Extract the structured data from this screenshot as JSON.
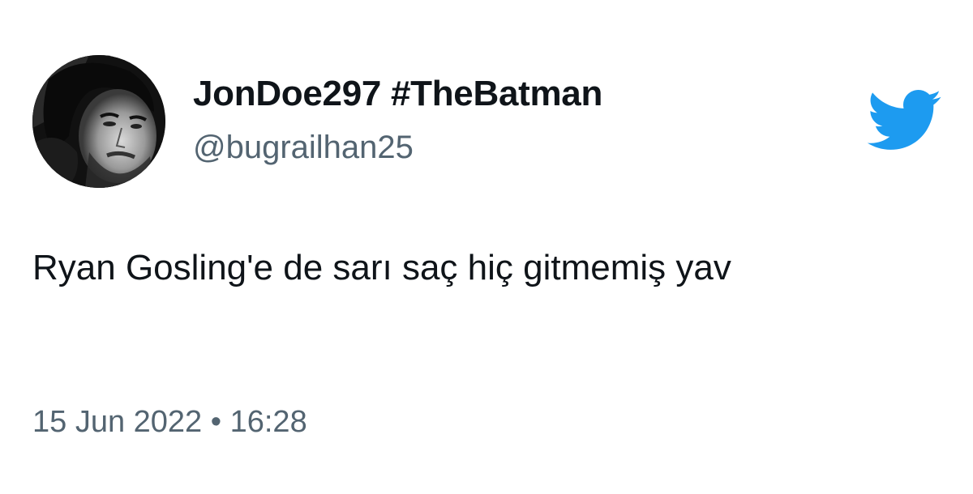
{
  "tweet": {
    "display_name": "JonDoe297 #TheBatman",
    "handle": "@bugrailhan25",
    "text": "Ryan Gosling'e de sarı saç hiç gitmemiş yav",
    "timestamp": "15 Jun 2022 • 16:28"
  },
  "icons": {
    "avatar": "user-avatar-photo",
    "brand": "twitter-bird-icon"
  },
  "colors": {
    "brand": "#1d9bf0",
    "primary_text": "#0f1419",
    "secondary_text": "#536471",
    "background": "#ffffff"
  }
}
